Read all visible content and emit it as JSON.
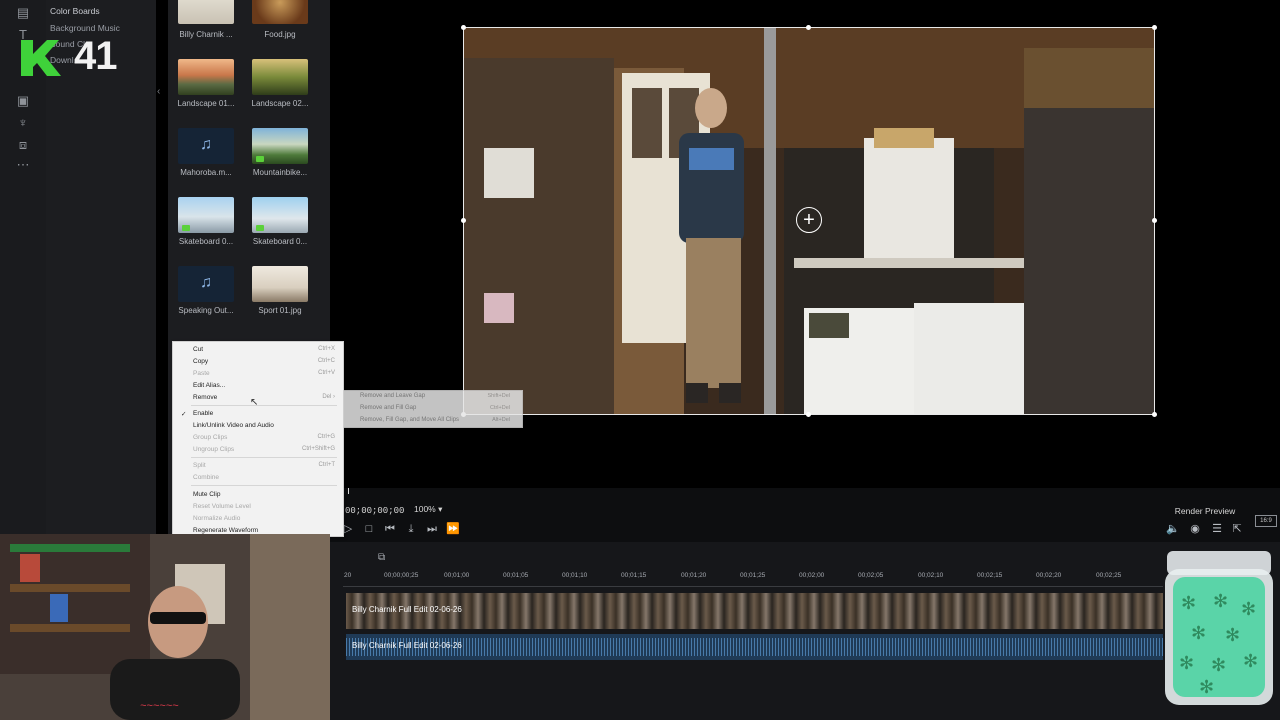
{
  "overlay": {
    "counter": "41"
  },
  "library": {
    "tree": [
      "Color Boards",
      "Background Music",
      "Sound Cl...",
      "Downl..."
    ]
  },
  "media": [
    {
      "caption": "Billy Charnik ...",
      "kind": "video"
    },
    {
      "caption": "Food.jpg",
      "kind": "image"
    },
    {
      "caption": "Landscape 01...",
      "kind": "image"
    },
    {
      "caption": "Landscape 02...",
      "kind": "image"
    },
    {
      "caption": "Mahoroba.m...",
      "kind": "audio"
    },
    {
      "caption": "Mountainbike...",
      "kind": "video"
    },
    {
      "caption": "Skateboard 0...",
      "kind": "video"
    },
    {
      "caption": "Skateboard 0...",
      "kind": "video"
    },
    {
      "caption": "Speaking Out...",
      "kind": "audio"
    },
    {
      "caption": "Sport 01.jpg",
      "kind": "image"
    }
  ],
  "context_menu": {
    "items": [
      {
        "label": "Cut",
        "shortcut": "Ctrl+X",
        "enabled": true
      },
      {
        "label": "Copy",
        "shortcut": "Ctrl+C",
        "enabled": true
      },
      {
        "label": "Paste",
        "shortcut": "Ctrl+V",
        "enabled": false
      },
      {
        "label": "Edit Alias...",
        "shortcut": "",
        "enabled": true
      },
      {
        "label": "Remove",
        "shortcut": "Del",
        "enabled": true,
        "submenu": true
      },
      {
        "label": "Enable",
        "shortcut": "",
        "enabled": true,
        "checked": true
      },
      {
        "label": "Link/Unlink Video and Audio",
        "shortcut": "",
        "enabled": true
      },
      {
        "label": "Group Clips",
        "shortcut": "Ctrl+G",
        "enabled": false
      },
      {
        "label": "Ungroup Clips",
        "shortcut": "Ctrl+Shift+G",
        "enabled": false
      },
      {
        "label": "Split",
        "shortcut": "Ctrl+T",
        "enabled": false
      },
      {
        "label": "Combine",
        "shortcut": "",
        "enabled": false
      },
      {
        "label": "Mute Clip",
        "shortcut": "",
        "enabled": true
      },
      {
        "label": "Reset Volume Level",
        "shortcut": "",
        "enabled": false
      },
      {
        "label": "Normalize Audio",
        "shortcut": "",
        "enabled": false
      },
      {
        "label": "Regenerate Waveform",
        "shortcut": "",
        "enabled": true
      }
    ],
    "submenu": [
      {
        "label": "Remove and Leave Gap",
        "shortcut": "Shift+Del"
      },
      {
        "label": "Remove and Fill Gap",
        "shortcut": "Ctrl+Del"
      },
      {
        "label": "Remove, Fill Gap, and Move All Clips",
        "shortcut": "Alt+Del"
      }
    ]
  },
  "player": {
    "timecode": "00;00;00;00",
    "zoom": "100%",
    "render_preview": "Render Preview",
    "aspect": "16:9"
  },
  "timeline": {
    "ticks": [
      "00;00;00;25",
      "00;01;00",
      "00;01;05",
      "00;01;10",
      "00;01;15",
      "00;01;20",
      "00;01;25",
      "00;02;00",
      "00;02;05",
      "00;02;10",
      "00;02;15",
      "00;02;20",
      "00;02;25"
    ],
    "ruler_start": "20",
    "video_clip_label": "Billy Charnik Full Edit 02-06-26",
    "audio_clip_label": "Billy Charnik Full Edit 02-06-26"
  },
  "colors": {
    "accent_green": "#5bd13a",
    "menu_bg": "#f2f2f2",
    "panel_bg": "#1c1d20"
  }
}
